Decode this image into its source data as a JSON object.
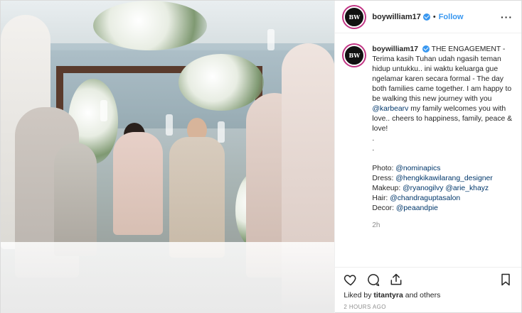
{
  "post": {
    "username": "boywilliam17",
    "follow_label": "Follow",
    "avatar_text": "BW",
    "caption": {
      "lines": [
        "THE ENGAGEMENT - Terima kasih Tuhan udah ngasih teman hidup untukku.. ini waktu keluarga gue ngelamar karen secara formal - The day both families came together. I am happy to be walking this new journey with you",
        "@karbearv",
        "my family welcomes you with love.. cheers to happiness, family, peace & love!"
      ],
      "dots": [
        ".",
        "."
      ],
      "credits": [
        {
          "label": "Photo: ",
          "mention": "@nominapics"
        },
        {
          "label": "Dress: ",
          "mention": "@hengkikawilarang_designer"
        },
        {
          "label": "Makeup: ",
          "mention": "@ryanogilvy",
          "extra": " @arie_khayz"
        },
        {
          "label": "Hair: ",
          "mention": "@chandraguptasalon"
        },
        {
          "label": "Decor: ",
          "mention": "@peaandpie"
        }
      ],
      "age": "2h"
    },
    "likes": {
      "prefix": "Liked by ",
      "user": "titantyra",
      "suffix": " and others"
    },
    "posted": "2 HOURS AGO"
  },
  "icons": [
    "heart-icon",
    "comment-icon",
    "share-icon",
    "bookmark-icon",
    "more-icon",
    "verified-icon"
  ],
  "colors": {
    "accent": "#3897f0",
    "mention": "#00376b",
    "muted": "#8e8e8e"
  }
}
